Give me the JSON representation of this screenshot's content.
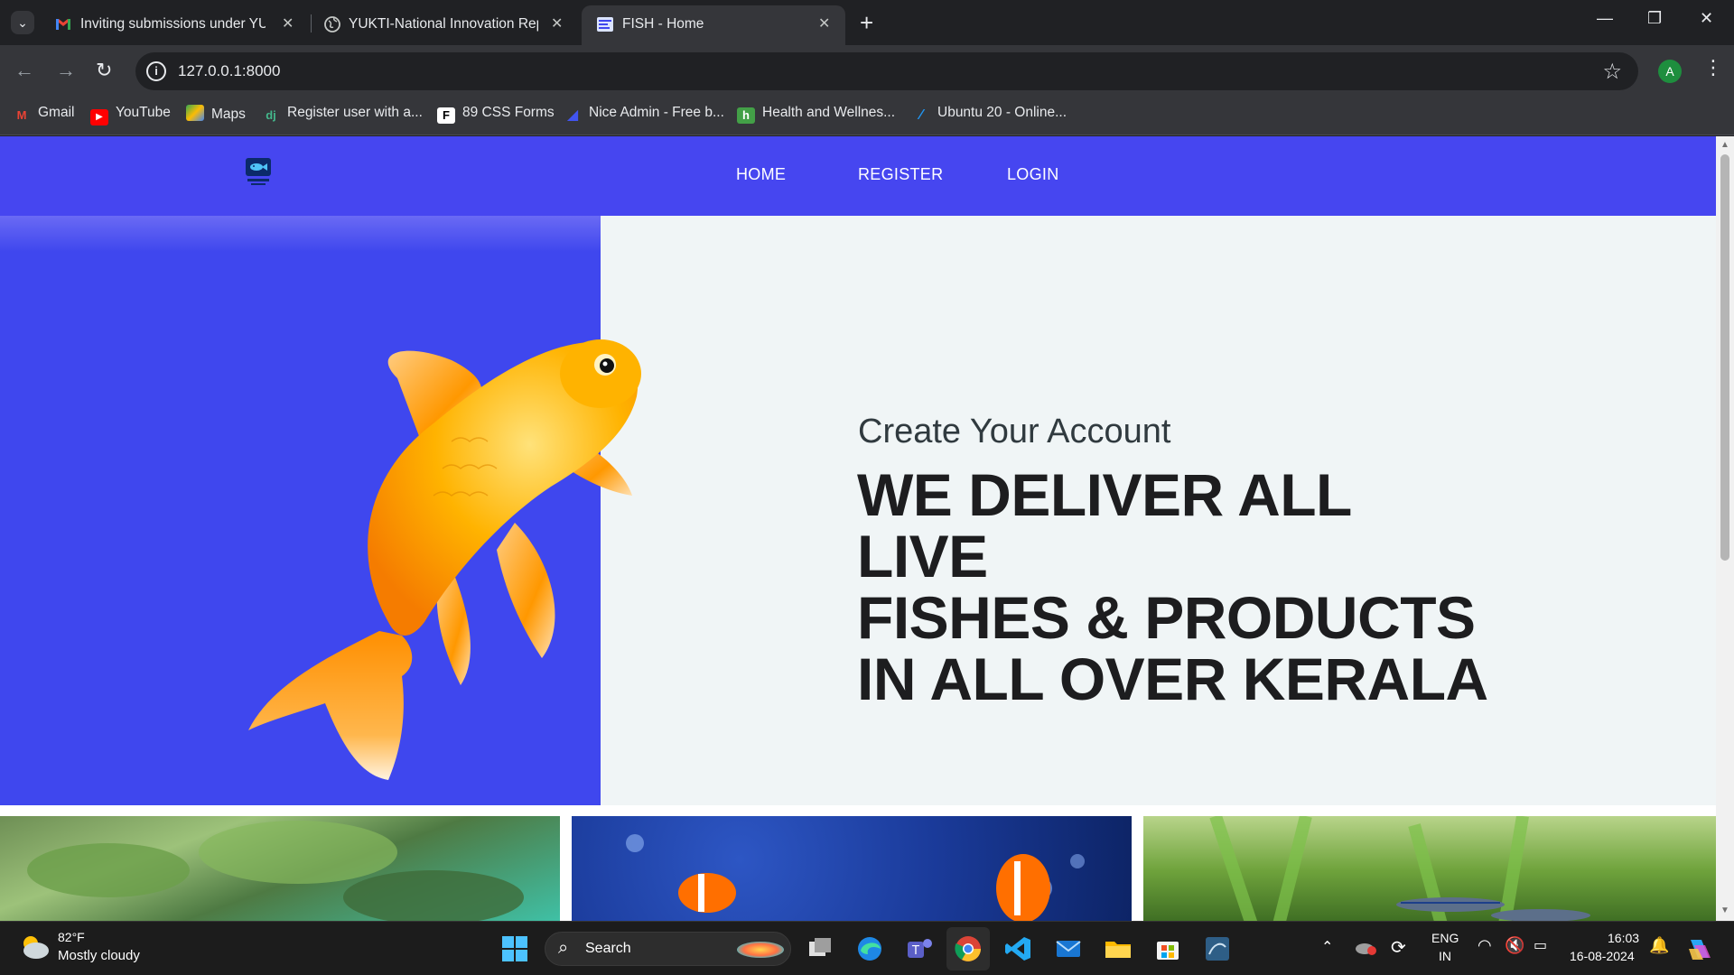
{
  "browser": {
    "tabs": [
      {
        "title": "Inviting submissions under YUK",
        "favicon": "gmail-icon",
        "active": false
      },
      {
        "title": "YUKTI-National Innovation Repo",
        "favicon": "globe-icon",
        "active": false
      },
      {
        "title": "FISH - Home",
        "favicon": "fish-site-icon",
        "active": true
      }
    ],
    "url": "127.0.0.1:8000",
    "profile_initial": "A",
    "bookmarks": [
      {
        "label": "Gmail",
        "icon": "gmail-icon"
      },
      {
        "label": "YouTube",
        "icon": "youtube-icon"
      },
      {
        "label": "Maps",
        "icon": "maps-icon"
      },
      {
        "label": "Register user with a...",
        "icon": "django-icon"
      },
      {
        "label": "89 CSS Forms",
        "icon": "freefrontend-icon"
      },
      {
        "label": "Nice Admin - Free b...",
        "icon": "niceadmin-icon"
      },
      {
        "label": "Health and Wellnes...",
        "icon": "h-icon"
      },
      {
        "label": "Ubuntu 20 - Online...",
        "icon": "onworks-icon"
      }
    ]
  },
  "site": {
    "nav": {
      "home": "HOME",
      "register": "REGISTER",
      "login": "LOGIN"
    },
    "hero": {
      "subtitle": "Create Your Account",
      "title_lines": [
        "WE DELIVER ALL LIVE",
        "FISHES & PRODUCTS",
        "IN ALL OVER KERALA"
      ]
    },
    "colors": {
      "nav_bg": "#4646f0",
      "hero_left_bg": "#3f47ee",
      "hero_right_bg": "#f0f5f6"
    }
  },
  "taskbar": {
    "weather_temp": "82°F",
    "weather_desc": "Mostly cloudy",
    "search_label": "Search",
    "lang_top": "ENG",
    "lang_bottom": "IN",
    "time": "16:03",
    "date": "16-08-2024"
  }
}
